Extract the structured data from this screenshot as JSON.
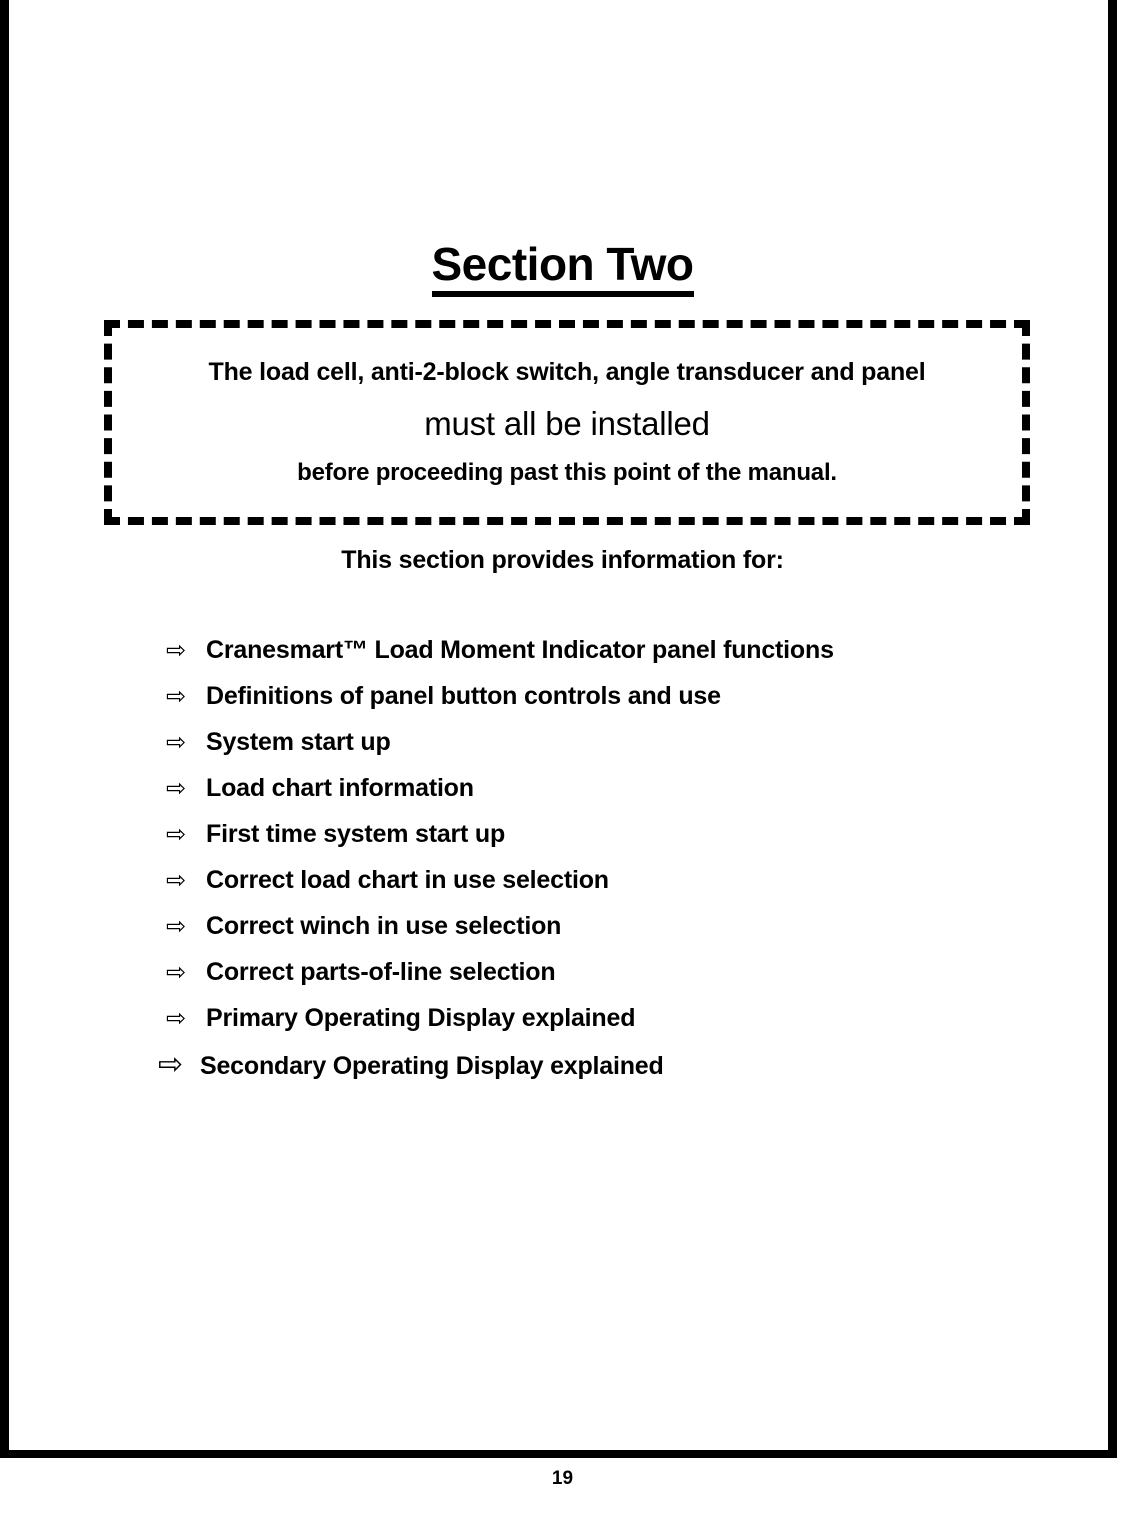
{
  "page": {
    "title": "Section Two",
    "number": "19"
  },
  "warning": {
    "line1": "The load cell, anti-2-block switch, angle transducer and panel",
    "line2": "must all be installed",
    "line3": "before proceeding past this point of the manual."
  },
  "intro": "This section provides information for:",
  "bullets": {
    "arrow_glyph": "⇨",
    "items": [
      {
        "label": "Cranesmart™ Load Moment Indicator panel functions"
      },
      {
        "label": "Definitions of panel button controls and use"
      },
      {
        "label": "System start up"
      },
      {
        "label": "Load chart information"
      },
      {
        "label": "First time system start up"
      },
      {
        "label": "Correct load chart in use selection"
      },
      {
        "label": "Correct winch in use selection"
      },
      {
        "label": "Correct parts-of-line selection"
      },
      {
        "label": "Primary Operating Display explained"
      },
      {
        "label": "Secondary Operating Display explained"
      }
    ]
  },
  "colors": {
    "ink": "#000000",
    "paper": "#ffffff"
  }
}
